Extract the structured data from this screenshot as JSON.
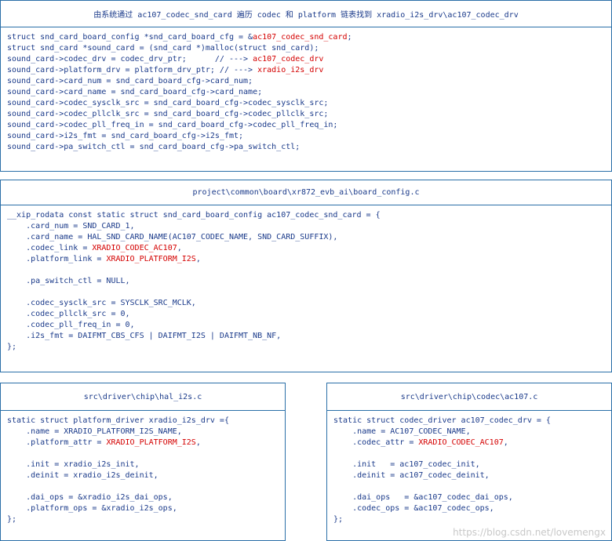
{
  "box1": {
    "title": "由系统通过 ac107_codec_snd_card 遍历 codec 和 platform 链表找到 xradio_i2s_drv\\ac107_codec_drv",
    "lines": [
      [
        {
          "t": "struct snd_card_board_config *snd_card_board_cfg = &"
        },
        {
          "t": "ac107_codec_snd_card",
          "r": true
        },
        {
          "t": ";"
        }
      ],
      [
        {
          "t": "struct snd_card *sound_card = (snd_card *)malloc(struct snd_card);"
        }
      ],
      [
        {
          "t": "sound_card->codec_drv = codec_drv_ptr;      // ---> "
        },
        {
          "t": "ac107_codec_drv",
          "r": true
        }
      ],
      [
        {
          "t": "sound_card->platform_drv = platform_drv_ptr; // ---> "
        },
        {
          "t": "xradio_i2s_drv",
          "r": true
        }
      ],
      [
        {
          "t": "sound_card->card_num = snd_card_board_cfg->card_num;"
        }
      ],
      [
        {
          "t": "sound_card->card_name = snd_card_board_cfg->card_name;"
        }
      ],
      [
        {
          "t": "sound_card->codec_sysclk_src = snd_card_board_cfg->codec_sysclk_src;"
        }
      ],
      [
        {
          "t": "sound_card->codec_pllclk_src = snd_card_board_cfg->codec_pllclk_src;"
        }
      ],
      [
        {
          "t": "sound_card->codec_pll_freq_in = snd_card_board_cfg->codec_pll_freq_in;"
        }
      ],
      [
        {
          "t": "sound_card->i2s_fmt = snd_card_board_cfg->i2s_fmt;"
        }
      ],
      [
        {
          "t": "sound_card->pa_switch_ctl = snd_card_board_cfg->pa_switch_ctl;"
        }
      ]
    ]
  },
  "box2": {
    "title": "project\\common\\board\\xr872_evb_ai\\board_config.c",
    "lines": [
      [
        {
          "t": "__xip_rodata const static struct snd_card_board_config ac107_codec_snd_card = {"
        }
      ],
      [
        {
          "t": "    .card_num = SND_CARD_1,"
        }
      ],
      [
        {
          "t": "    .card_name = HAL_SND_CARD_NAME(AC107_CODEC_NAME, SND_CARD_SUFFIX),"
        }
      ],
      [
        {
          "t": "    .codec_link = "
        },
        {
          "t": "XRADIO_CODEC_AC107",
          "r": true
        },
        {
          "t": ","
        }
      ],
      [
        {
          "t": "    .platform_link = "
        },
        {
          "t": "XRADIO_PLATFORM_I2S",
          "r": true
        },
        {
          "t": ","
        }
      ],
      [
        {
          "t": ""
        }
      ],
      [
        {
          "t": "    .pa_switch_ctl = NULL,"
        }
      ],
      [
        {
          "t": ""
        }
      ],
      [
        {
          "t": "    .codec_sysclk_src = SYSCLK_SRC_MCLK,"
        }
      ],
      [
        {
          "t": "    .codec_pllclk_src = 0,"
        }
      ],
      [
        {
          "t": "    .codec_pll_freq_in = 0,"
        }
      ],
      [
        {
          "t": "    .i2s_fmt = DAIFMT_CBS_CFS | DAIFMT_I2S | DAIFMT_NB_NF,"
        }
      ],
      [
        {
          "t": "};"
        }
      ]
    ]
  },
  "box3": {
    "title": "src\\driver\\chip\\hal_i2s.c",
    "lines": [
      [
        {
          "t": "static struct platform_driver xradio_i2s_drv ={"
        }
      ],
      [
        {
          "t": "    .name = XRADIO_PLATFORM_I2S_NAME,"
        }
      ],
      [
        {
          "t": "    .platform_attr = "
        },
        {
          "t": "XRADIO_PLATFORM_I2S",
          "r": true
        },
        {
          "t": ","
        }
      ],
      [
        {
          "t": ""
        }
      ],
      [
        {
          "t": "    .init = xradio_i2s_init,"
        }
      ],
      [
        {
          "t": "    .deinit = xradio_i2s_deinit,"
        }
      ],
      [
        {
          "t": ""
        }
      ],
      [
        {
          "t": "    .dai_ops = &xradio_i2s_dai_ops,"
        }
      ],
      [
        {
          "t": "    .platform_ops = &xradio_i2s_ops,"
        }
      ],
      [
        {
          "t": "};"
        }
      ]
    ]
  },
  "box4": {
    "title": "src\\driver\\chip\\codec\\ac107.c",
    "lines": [
      [
        {
          "t": "static struct codec_driver ac107_codec_drv = {"
        }
      ],
      [
        {
          "t": "    .name = AC107_CODEC_NAME,"
        }
      ],
      [
        {
          "t": "    .codec_attr = "
        },
        {
          "t": "XRADIO_CODEC_AC107",
          "r": true
        },
        {
          "t": ","
        }
      ],
      [
        {
          "t": ""
        }
      ],
      [
        {
          "t": "    .init   = ac107_codec_init,"
        }
      ],
      [
        {
          "t": "    .deinit = ac107_codec_deinit,"
        }
      ],
      [
        {
          "t": ""
        }
      ],
      [
        {
          "t": "    .dai_ops   = &ac107_codec_dai_ops,"
        }
      ],
      [
        {
          "t": "    .codec_ops = &ac107_codec_ops,"
        }
      ],
      [
        {
          "t": "};"
        }
      ]
    ]
  },
  "watermark": "https://blog.csdn.net/lovemengx",
  "colors": {
    "border": "#2a6fa8",
    "text": "#1a3a8a",
    "highlight": "#d40000"
  }
}
